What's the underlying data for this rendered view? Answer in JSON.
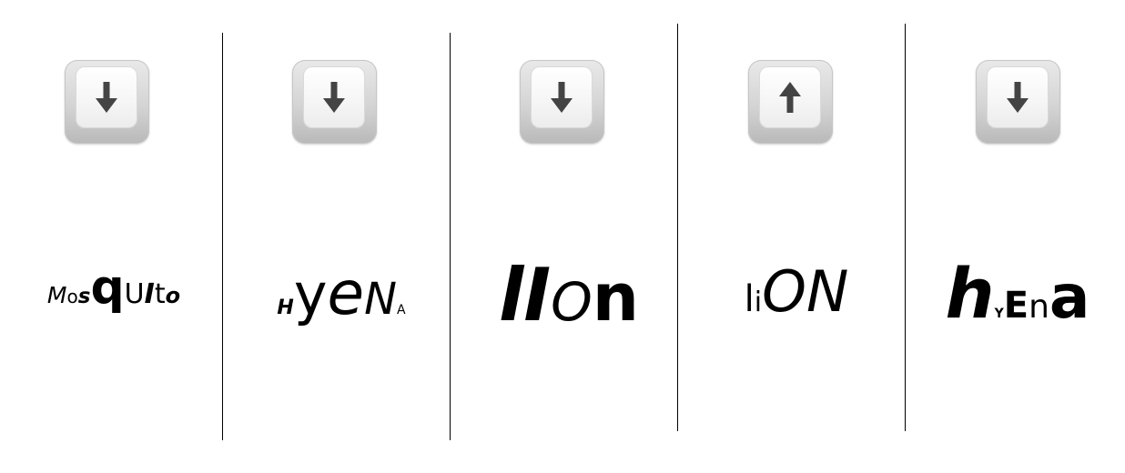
{
  "panels": [
    {
      "key_icon": "arrow-down-icon",
      "word_letters": [
        "M",
        "o",
        "s",
        "q",
        "U",
        "I",
        "t",
        "o"
      ]
    },
    {
      "key_icon": "arrow-down-icon",
      "word_letters": [
        "H",
        "y",
        "e",
        "N",
        "A"
      ]
    },
    {
      "key_icon": "arrow-down-icon",
      "word_letters": [
        "l",
        "I",
        "O",
        "n"
      ]
    },
    {
      "key_icon": "arrow-up-icon",
      "word_letters": [
        "l",
        "i",
        "O",
        "N"
      ]
    },
    {
      "key_icon": "arrow-down-icon",
      "word_letters": [
        "h",
        "Y",
        "E",
        "n",
        "a"
      ]
    }
  ],
  "colors": {
    "arrow": "#444444",
    "divider": "#000000",
    "text": "#000000"
  }
}
